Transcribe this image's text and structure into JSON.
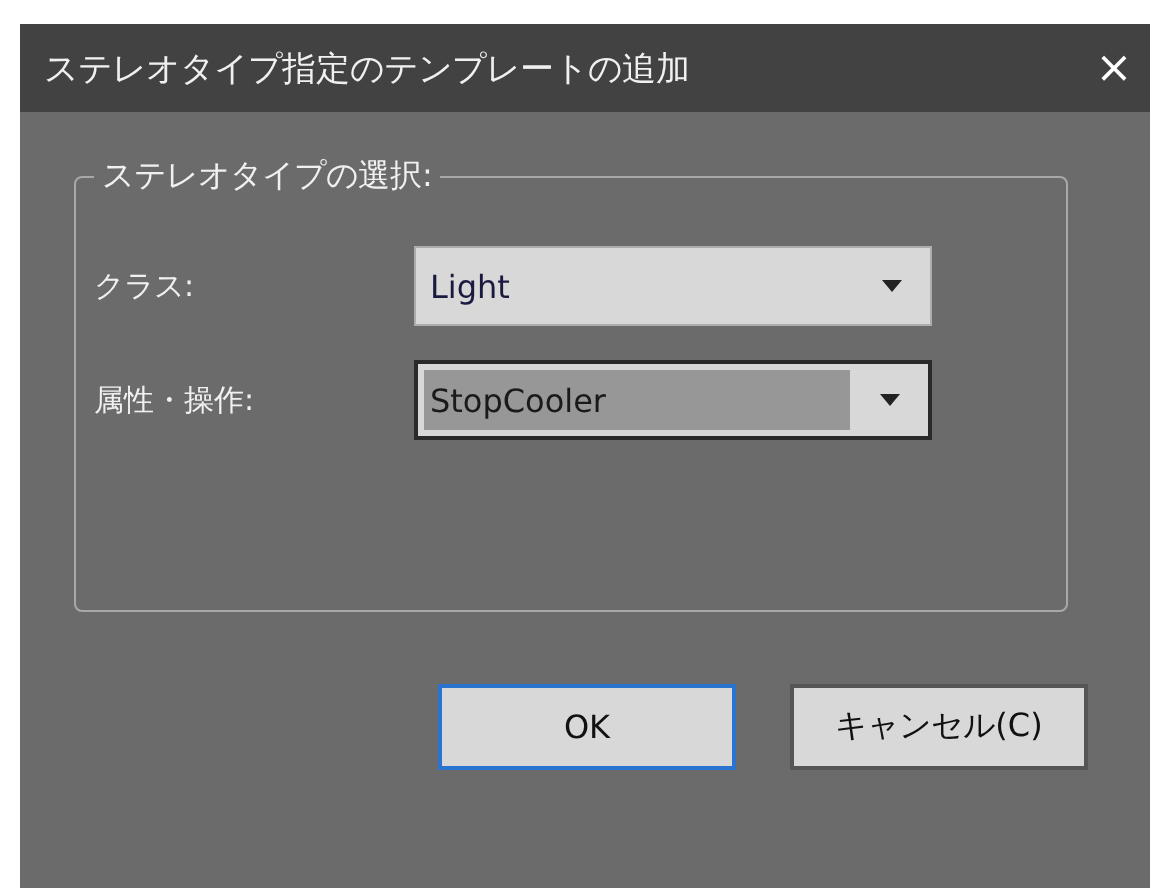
{
  "window": {
    "title": "ステレオタイプ指定のテンプレートの追加",
    "close": "×"
  },
  "group": {
    "title": "ステレオタイプの選択:",
    "fields": [
      {
        "label": "クラス:",
        "value": "Light",
        "focused": false
      },
      {
        "label": "属性・操作:",
        "value": "StopCooler",
        "focused": true
      }
    ]
  },
  "buttons": [
    {
      "label": "OK",
      "default": true
    },
    {
      "label": "キャンセル(C)",
      "default": false
    }
  ]
}
